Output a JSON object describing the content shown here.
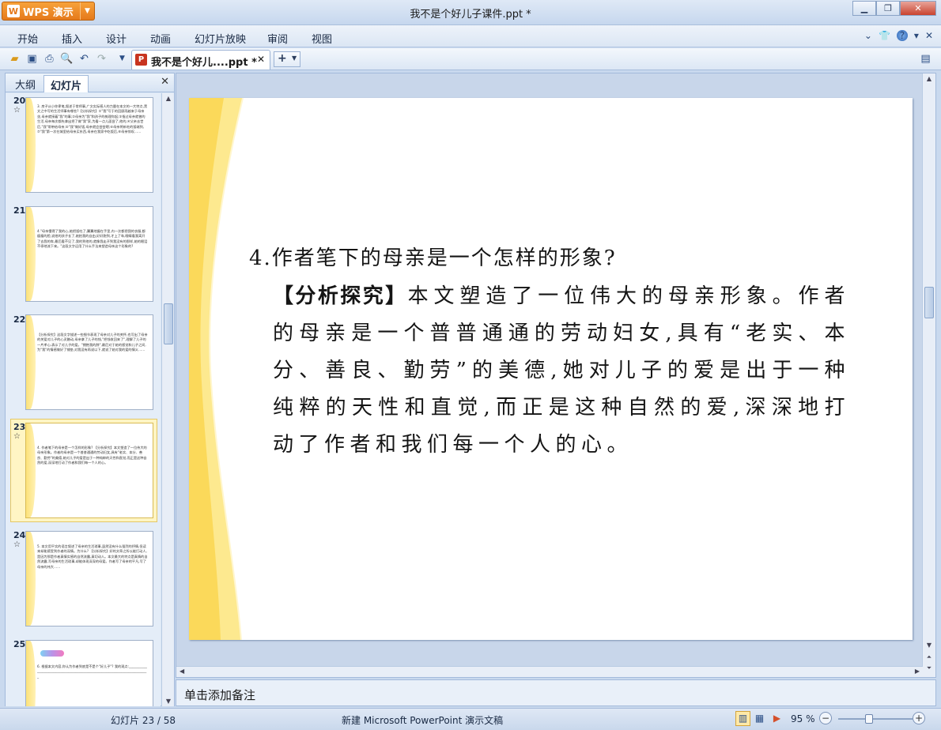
{
  "app": {
    "name": "WPS 演示",
    "title": "我不是个好儿子课件.ppt *"
  },
  "menu": [
    "开始",
    "插入",
    "设计",
    "动画",
    "幻灯片放映",
    "审阅",
    "视图"
  ],
  "tab": {
    "label": "我不是个好儿....ppt *"
  },
  "panel": {
    "tabs": [
      "大纲",
      "幻灯片"
    ],
    "active_tab": "幻灯片"
  },
  "thumbnails": [
    {
      "num": "20",
      "star": true,
      "text": "3. 房子从小你卑笔,叙述于常师事,广文实际感人的力量在本文的一大特点,黑文之中写的生活师事有哪些?【分析探究】①\"我\"写于的回顾雨越来于母亲坐,母亲就接着\"我\"的事;②母亲为\"我\"和孩子的梳理你起;③指过母亲就曾的生活,母亲每次都先拿出把了做\"我\"家,为看一点儿面尝了,他的,④父亲去世后,\"我\"常带给母亲;⑤\"我\"做好饭,母亲就会尝尝嗯;⑥母亲将新吃的饭端到,⑦\"我\"第一次在城里给母亲买东西,母亲在我家中吃饭后,⑧母亲惊叹……"
    },
    {
      "num": "21",
      "star": false,
      "text": "4.\"母亲懂得了我的心,她把饭吃了,翼翼地握在手里,内一次都把我的衣服,都瘦瘦的脸,说他的孩子长了,她拍我的自由,好好跑到,才上了车,眼睛看我离开了去我的车,最后看不见了,我的到他的,就像我走开到我没有的那样,她的眼泪不停地流下来。\"这段文字运用了什么手法来塑造母亲这个形象的?"
    },
    {
      "num": "22",
      "star": false,
      "text": "【分析探究】这段文字描述一些细节表现了母亲对儿子的关怀,也写出了母亲的关爱对儿子的心灵触动,母亲拿了儿子的钱,\"把钱收回来了\",理解了儿子的一片孝心,表示了对儿子的爱。\"拥抱我的脖\",最后对于她的感觉和儿子之间,为\"我\"的情感做好了铺垫,对我没有再说以下,就说了她对我的爱的情义……"
    },
    {
      "num": "23",
      "star": true,
      "selected": true,
      "text": "4. 作者笔下的母亲是一个怎样的形象? 【分析探究】本文塑造了一位伟大的母亲形象。作者的母亲是一个普普通通的劳动妇女,具有\"老实、本分、善良、勤劳\"的美德,她对儿子的爱是出于一种纯粹的天性和直觉,而正是这种自然的爱,深深地打动了作者和我们每一个人的心。"
    },
    {
      "num": "24",
      "star": true,
      "text": "5. 本文用平实的语言叙述了母亲的生活琐事,虽然没有什么强烈的抒情,但读来却能感受到作者的深情。为什么? 【分析探究】好的文章之所以能打动人,是因为那是作者真情实感的自然流露,真切动人。本文最大的特点是真情的自然流露,写母亲的生活琐事,却能体现深深的母爱。作者写了母亲的平凡,写了母亲的伟大……"
    },
    {
      "num": "25",
      "star": false,
      "banner": true,
      "text": "6. 根据本文内容,你认为作者到底是不是个\"好儿子\"? 我的观点:______________________________________________________________________________"
    }
  ],
  "slide": {
    "question": "4.作者笔下的母亲是一个怎样的形象?",
    "answer_tag": "【分析探究】",
    "answer": "本文塑造了一位伟大的母亲形象。作者的母亲是一个普普通通的劳动妇女,具有“老实、本分、善良、勤劳”的美德,她对儿子的爱是出于一种纯粹的天性和直觉,而正是这种自然的爱,深深地打动了作者和我们每一个人的心。"
  },
  "notes": {
    "placeholder": "单击添加备注"
  },
  "status": {
    "slide": "幻灯片 23 / 58",
    "doc_type": "新建 Microsoft PowerPoint 演示文稿",
    "zoom": "95 %",
    "zoom_fraction": 0.95
  },
  "colors": {
    "accent": "#e5791b",
    "slide_deco": "#fce27a",
    "selection": "#fff5c4"
  }
}
